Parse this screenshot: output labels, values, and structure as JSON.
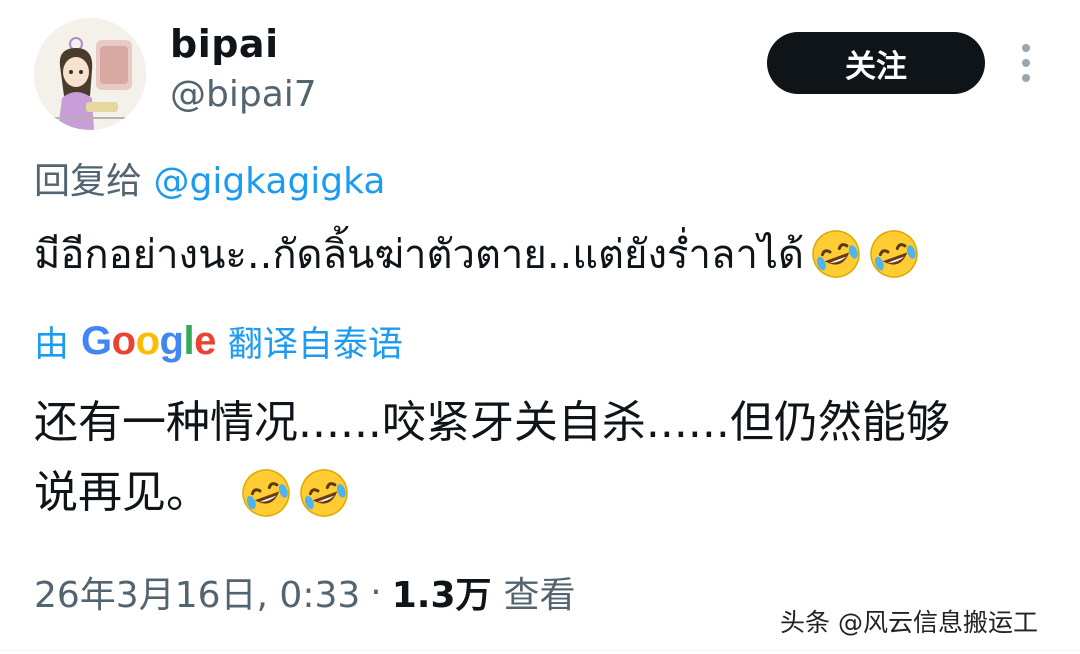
{
  "header": {
    "display_name": "bipai",
    "handle": "@bipai7",
    "follow_label": "关注"
  },
  "reply": {
    "prefix": "回复给",
    "mention": "@gigkagigka"
  },
  "original_text": "มีอีกอย่างนะ..กัดลิ้นฆ่าตัวตาย..แต่ยังร่ำลาได้",
  "translation_notice": {
    "prefix": "由",
    "provider": "Google",
    "suffix": "翻译自泰语"
  },
  "translated_text": {
    "line1": "还有一种情况......咬紧牙关自杀......但仍然能够",
    "line2": "说再见。"
  },
  "meta": {
    "timestamp": "26年3月16日, 0:33",
    "separator": "·",
    "views_count": "1.3万",
    "views_label": "查看"
  },
  "watermark": "头条 @风云信息搬运工",
  "icons": {
    "emoji": "rolling-on-the-floor-laughing",
    "more": "more-vertical-icon"
  }
}
